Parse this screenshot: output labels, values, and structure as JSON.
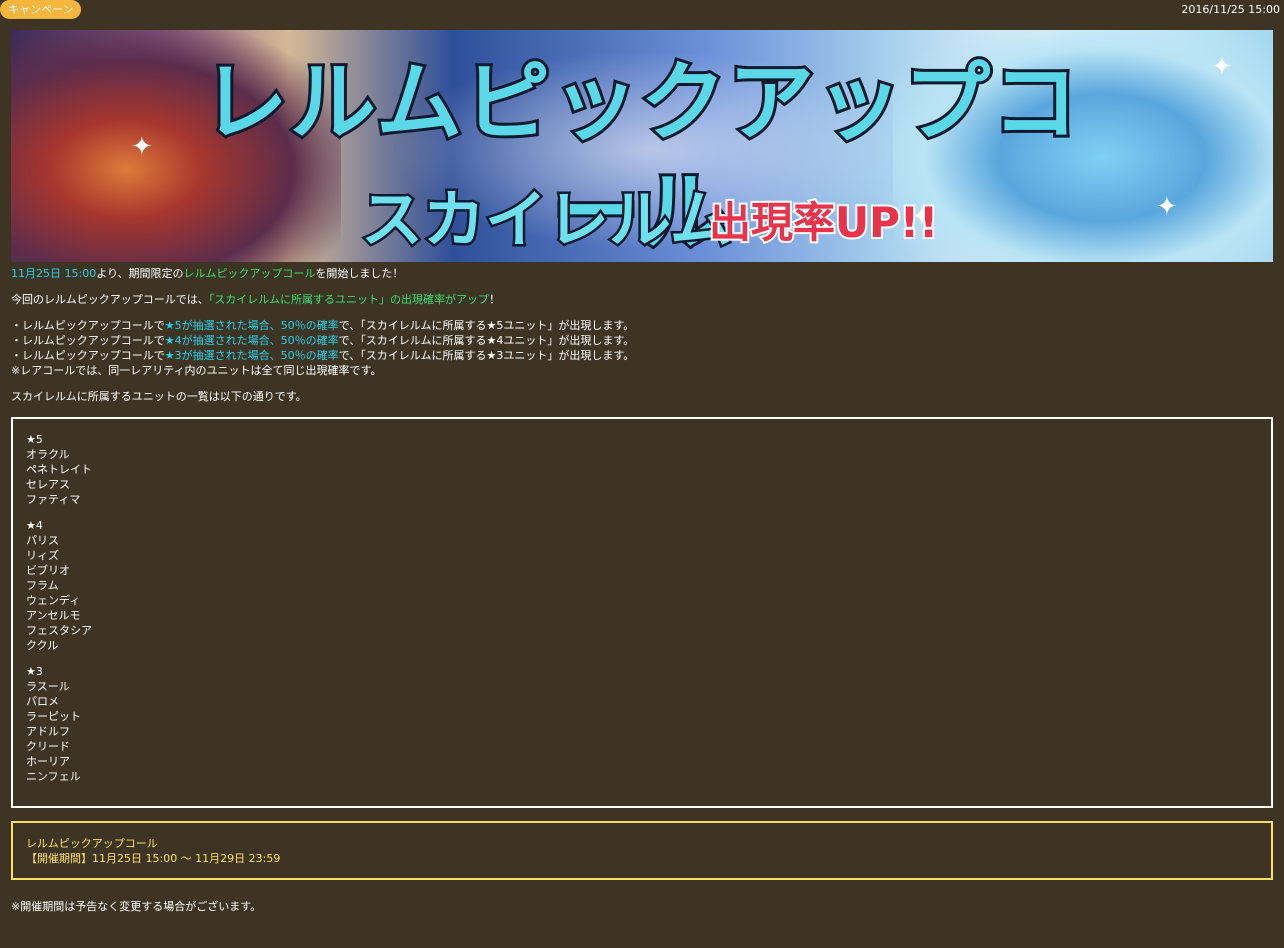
{
  "header": {
    "badge": "キャンペーン",
    "date": "2016/11/25 15:00"
  },
  "banner": {
    "title_line1": "レルムピックアップコール",
    "title_line2": "スカイレルム",
    "title_line3": "出現率UP!!"
  },
  "intro": {
    "date_highlight": "11月25日 15:00",
    "text1": "より、期間限定の",
    "event_name": "レルムピックアップコール",
    "text2": "を開始しました！"
  },
  "line2": {
    "prefix": "今回のレルムピックアップコールでは、",
    "highlight": "「スカイレルムに所属するユニット」の出現確率がアップ",
    "suffix": "！"
  },
  "rates": [
    {
      "prefix": "・レルムピックアップコールで",
      "highlight": "★5が抽選された場合、50％の確率",
      "suffix": "で、「スカイレルムに所属する★5ユニット」が出現します。"
    },
    {
      "prefix": "・レルムピックアップコールで",
      "highlight": "★4が抽選された場合、50％の確率",
      "suffix": "で、「スカイレルムに所属する★4ユニット」が出現します。"
    },
    {
      "prefix": "・レルムピックアップコールで",
      "highlight": "★3が抽選された場合、50％の確率",
      "suffix": "で、「スカイレルムに所属する★3ユニット」が出現します。"
    }
  ],
  "rare_note": "※レアコールでは、同一レアリティ内のユニットは全て同じ出現確率です。",
  "list_intro": "スカイレルムに所属するユニットの一覧は以下の通りです。",
  "units": {
    "star5": {
      "label": "★5",
      "names": [
        "オラクル",
        "ペネトレイト",
        "セレアス",
        "ファティマ"
      ]
    },
    "star4": {
      "label": "★4",
      "names": [
        "パリス",
        "リィズ",
        "ビブリオ",
        "フラム",
        "ウェンディ",
        "アンセルモ",
        "フェスタシア",
        "ククル"
      ]
    },
    "star3": {
      "label": "★3",
      "names": [
        "ラスール",
        "パロメ",
        "ラーピット",
        "アドルフ",
        "クリード",
        "ホーリア",
        "ニンフェル"
      ]
    }
  },
  "event": {
    "name": "レルムピックアップコール",
    "period": "【開催期間】11月25日 15:00 ～ 11月29日 23:59"
  },
  "footnote": "※開催期間は予告なく変更する場合がございます。",
  "colors": {
    "background": "#3e3424",
    "badge": "#f6b63c",
    "cyan": "#22d3ee",
    "green": "#35e06a",
    "event_border": "#ffe060"
  }
}
